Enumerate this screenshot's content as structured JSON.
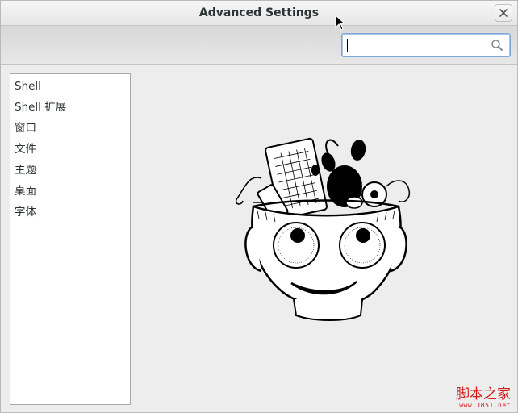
{
  "window": {
    "title": "Advanced Settings",
    "close_icon": "close-icon"
  },
  "toolbar": {
    "search": {
      "value": "",
      "placeholder": "",
      "icon": "search-icon"
    }
  },
  "sidebar": {
    "items": [
      {
        "label": "Shell"
      },
      {
        "label": "Shell 扩展"
      },
      {
        "label": "窗口"
      },
      {
        "label": "文件"
      },
      {
        "label": "主题"
      },
      {
        "label": "桌面"
      },
      {
        "label": "字体"
      }
    ]
  },
  "illustration": {
    "icon": "tweak-tool-mascot-icon"
  },
  "watermark": {
    "main": "脚本之家",
    "sub": "www.JB51.net"
  },
  "colors": {
    "focus_border": "#7da7d9",
    "watermark": "#d11b1b"
  }
}
